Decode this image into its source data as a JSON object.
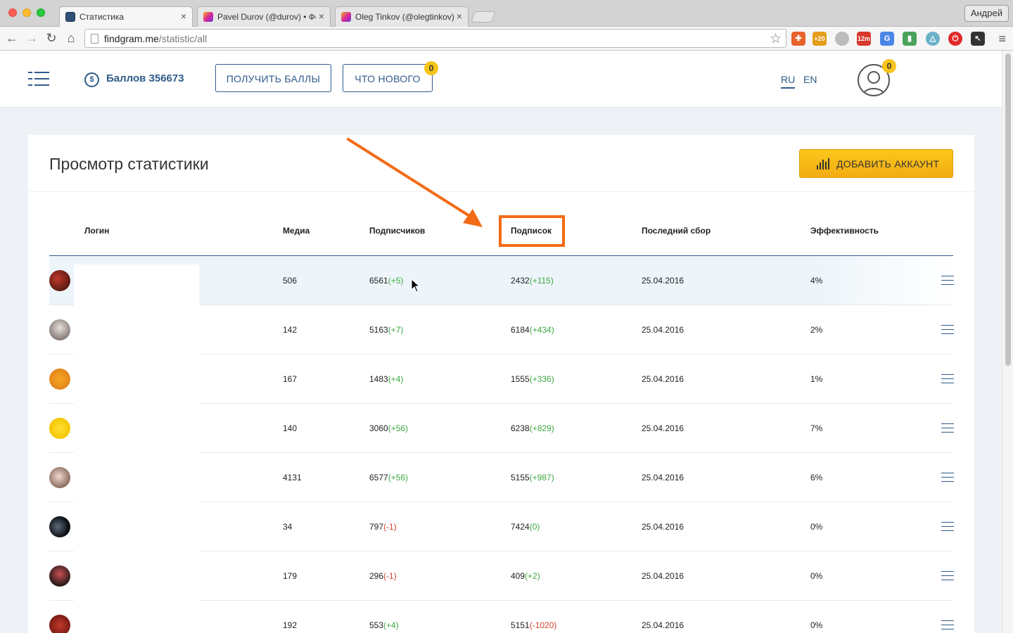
{
  "browser": {
    "tabs": [
      {
        "title": "Статистика",
        "favicon": "findgram-icon",
        "active": true
      },
      {
        "title": "Pavel Durov (@durov) • Фо",
        "favicon": "instagram-icon",
        "active": false
      },
      {
        "title": "Oleg Tinkov (@olegtinkov)",
        "favicon": "instagram-icon",
        "active": false
      }
    ],
    "profile_name": "Андрей",
    "url_host": "findgram.me",
    "url_path": "/statistic/all",
    "extension_badges": {
      "plus20": "+20",
      "timer": "12m"
    }
  },
  "header": {
    "points_icon": "$",
    "points_label": "Баллов 356673",
    "get_points_label": "ПОЛУЧИТЬ БАЛЛЫ",
    "whats_new_label": "ЧТО НОВОГО",
    "whats_new_badge": "0",
    "lang_ru": "RU",
    "lang_en": "EN",
    "avatar_badge": "0"
  },
  "page": {
    "title": "Просмотр статистики",
    "add_account_label": "ДОБАВИТЬ АККАУНТ"
  },
  "table": {
    "columns": {
      "login": "Логин",
      "media": "Медиа",
      "followers": "Подписчиков",
      "following": "Подписок",
      "last_collect": "Последний сбор",
      "efficiency": "Эффективность"
    },
    "rows": [
      {
        "media": "506",
        "followers": "6561",
        "followers_delta": "(+5)",
        "following": "2432",
        "following_delta": "(+115)",
        "date": "25.04.2016",
        "eff": "4%"
      },
      {
        "media": "142",
        "followers": "5163",
        "followers_delta": "(+7)",
        "following": "6184",
        "following_delta": "(+434)",
        "date": "25.04.2016",
        "eff": "2%"
      },
      {
        "media": "167",
        "followers": "1483",
        "followers_delta": "(+4)",
        "following": "1555",
        "following_delta": "(+336)",
        "date": "25.04.2016",
        "eff": "1%"
      },
      {
        "media": "140",
        "followers": "3060",
        "followers_delta": "(+56)",
        "following": "6238",
        "following_delta": "(+829)",
        "date": "25.04.2016",
        "eff": "7%"
      },
      {
        "media": "4131",
        "followers": "6577",
        "followers_delta": "(+56)",
        "following": "5155",
        "following_delta": "(+987)",
        "date": "25.04.2016",
        "eff": "6%"
      },
      {
        "media": "34",
        "followers": "797",
        "followers_delta": "(-1)",
        "following": "7424",
        "following_delta": "(0)",
        "date": "25.04.2016",
        "eff": "0%"
      },
      {
        "media": "179",
        "followers": "296",
        "followers_delta": "(-1)",
        "following": "409",
        "following_delta": "(+2)",
        "date": "25.04.2016",
        "eff": "0%"
      },
      {
        "media": "192",
        "followers": "553",
        "followers_delta": "(+4)",
        "following": "5151",
        "following_delta": "(-1020)",
        "date": "25.04.2016",
        "eff": "0%"
      }
    ]
  },
  "colors": {
    "brand": "#2f5b8b",
    "accent_button": "#f7b718",
    "positive": "#3ea842",
    "negative": "#d2412f",
    "annotation": "#f26b15"
  }
}
